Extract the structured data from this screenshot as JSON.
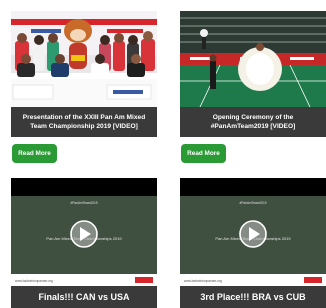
{
  "cards": [
    {
      "title": "Presentation of the XXIII Pan Am Mixed Team Championship 2019 [VIDEO]",
      "read_more": "Read More"
    },
    {
      "title": "Opening Ceremony of the #PanAmTeam2019 [VIDEO]",
      "read_more": "Read More"
    }
  ],
  "videos": [
    {
      "hashtag": "#PanAmTeam2019",
      "overlay_title": "Pan Am Mixed Team Championships 2019",
      "footer_url": "www.badmintonpanam.org",
      "title": "Finals!!! CAN vs USA"
    },
    {
      "hashtag": "#PanAmTeam2019",
      "overlay_title": "Pan Am Mixed Team Championships 2019",
      "footer_url": "www.badmintonpanam.org",
      "title": "3rd Place!!! BRA vs CUB"
    }
  ]
}
